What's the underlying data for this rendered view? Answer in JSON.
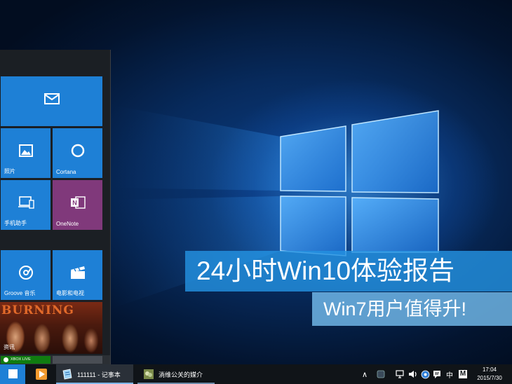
{
  "start_menu": {
    "tiles": [
      {
        "id": "mail",
        "label": "",
        "icon": "mail-icon"
      },
      {
        "id": "photos",
        "label": "照片",
        "icon": "photo-icon"
      },
      {
        "id": "cortana",
        "label": "Cortana",
        "icon": "cortana-ring-icon"
      },
      {
        "id": "phone",
        "label": "手机助手",
        "icon": "phone-companion-icon"
      },
      {
        "id": "onenote",
        "label": "OneNote",
        "icon": "onenote-icon"
      },
      {
        "id": "groove",
        "label": "Groove 音乐",
        "icon": "groove-music-icon"
      },
      {
        "id": "movies",
        "label": "电影和电视",
        "icon": "clapperboard-icon"
      },
      {
        "id": "news",
        "label": "资讯",
        "image_title": "BURNING"
      }
    ],
    "xbox_label": "XBOX LIVE"
  },
  "banner": {
    "line1": "24小时Win10体验报告",
    "line2": "Win7用户值得升!"
  },
  "taskbar": {
    "apps": [
      {
        "id": "notepad",
        "label": "111111 - 记事本",
        "icon": "notepad-icon"
      },
      {
        "id": "chat",
        "label": "淌维公关的媒介",
        "icon": "chat-app-icon"
      }
    ],
    "tray": {
      "chevron": "∧",
      "ime": "中",
      "m_badge": "M"
    },
    "clock": {
      "time": "17:04",
      "date": "2015/7/30"
    }
  },
  "colors": {
    "tile_blue": "#1e80d6",
    "onenote_purple": "#80397b",
    "banner_blue": "#2391e1",
    "taskbar": "#101418"
  }
}
